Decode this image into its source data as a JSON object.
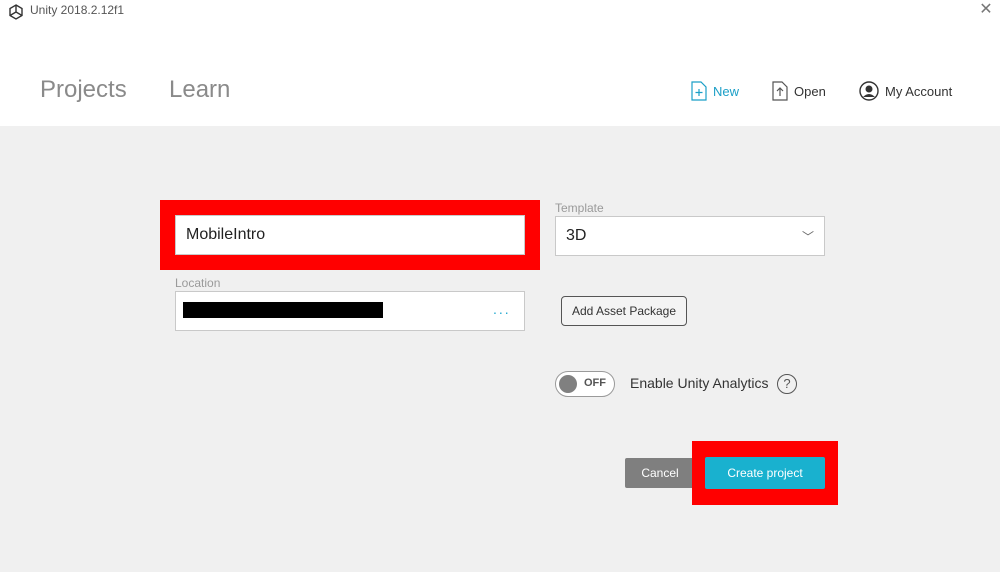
{
  "window": {
    "title": "Unity 2018.2.12f1",
    "logo_icon": "unity-logo-icon",
    "close_icon": "close-icon"
  },
  "nav": {
    "tabs": [
      "Projects",
      "Learn"
    ]
  },
  "actions": {
    "new_label": "New",
    "open_label": "Open",
    "account_label": "My Account"
  },
  "form": {
    "project_name_value": "MobileIntro",
    "location_label": "Location",
    "location_value_redacted": true,
    "browse_label": "...",
    "template_label": "Template",
    "template_value": "3D",
    "add_asset_label": "Add Asset Package",
    "analytics_toggle_state": "OFF",
    "analytics_label": "Enable Unity Analytics",
    "help_label": "?"
  },
  "buttons": {
    "cancel_label": "Cancel",
    "create_label": "Create project"
  },
  "colors": {
    "accent": "#1b9fc7",
    "create_button": "#19b1cf",
    "highlight": "#ff0000",
    "cancel_button": "#7f7f7f"
  }
}
